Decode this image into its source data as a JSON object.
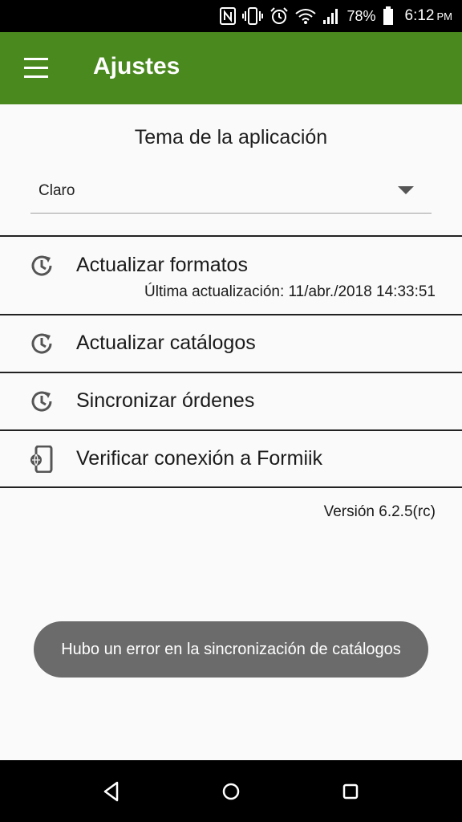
{
  "status_bar": {
    "battery_percent": "78%",
    "time": "6:12",
    "ampm": "PM",
    "icons": [
      "nfc-icon",
      "vibrate-icon",
      "alarm-icon",
      "wifi-icon",
      "signal-icon",
      "battery-icon"
    ]
  },
  "app_bar": {
    "title": "Ajustes",
    "menu_icon": "menu-icon"
  },
  "theme": {
    "title": "Tema de la aplicación",
    "selected": "Claro"
  },
  "settings_items": [
    {
      "label": "Actualizar formatos",
      "sublabel": "Última actualización: 11/abr./2018 14:33:51",
      "icon": "history-icon"
    },
    {
      "label": "Actualizar catálogos",
      "icon": "history-icon"
    },
    {
      "label": "Sincronizar órdenes",
      "icon": "history-icon"
    },
    {
      "label": "Verificar conexión a Formiik",
      "icon": "phone-web-icon"
    }
  ],
  "version": "Versión 6.2.5(rc)",
  "toast": {
    "message": "Hubo un error en la sincronización de catálogos"
  },
  "nav_bar": {
    "icons": [
      "back-icon",
      "home-icon",
      "recents-icon"
    ]
  },
  "colors": {
    "app_bar": "#4a891e",
    "background": "#fafafa",
    "toast": "#6b6b6b",
    "status_bar": "#000000"
  }
}
